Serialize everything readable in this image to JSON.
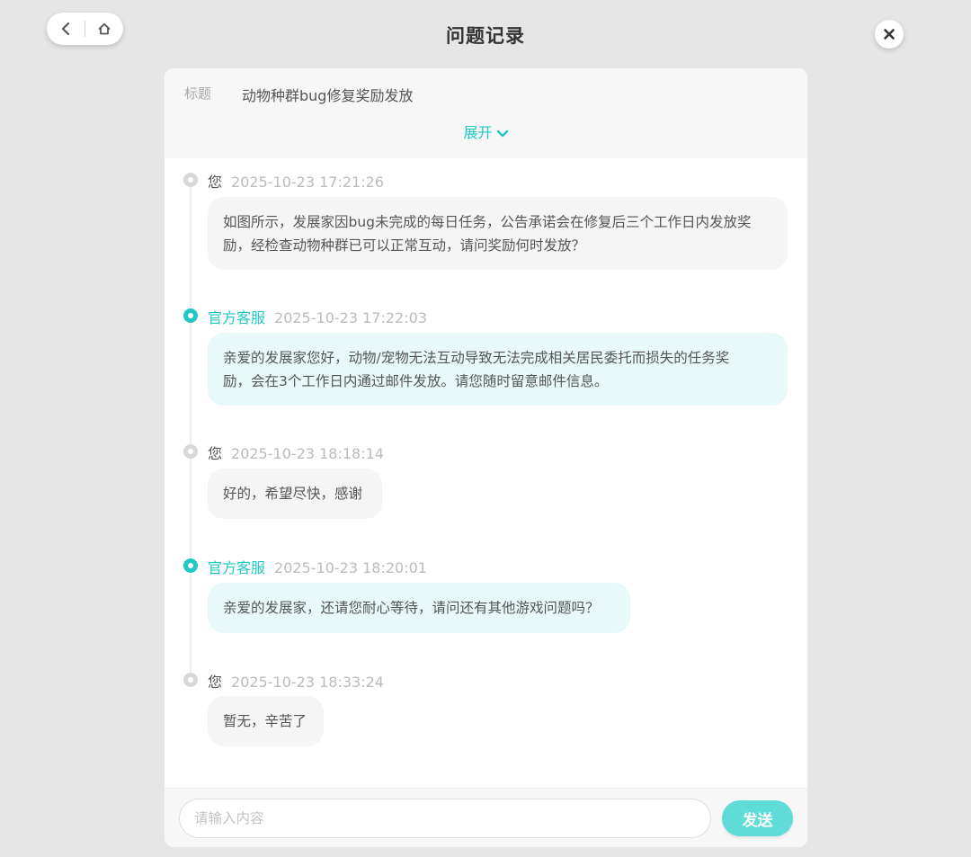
{
  "nav": {
    "back_icon": "chevron-left-icon",
    "home_icon": "home-icon",
    "close_icon": "close-icon"
  },
  "page_title": "问题记录",
  "header": {
    "label": "标题",
    "title": "动物种群bug修复奖励发放",
    "expand_label": "展开"
  },
  "colors": {
    "accent": "#22c9c4",
    "staff_bubble": "#e9f8f8",
    "user_bubble": "#f5f5f5",
    "send_button": "#5fdcd6"
  },
  "messages": [
    {
      "role": "user",
      "sender": "您",
      "time": "2025-10-23 17:21:26",
      "line1": "如图所示，发展家因bug未完成的每日任务，公告承诺会在修复后三个工作日内发放奖",
      "line2": "励，经检查动物种群已可以正常互动，请问奖励何时发放？"
    },
    {
      "role": "staff",
      "sender": "官方客服",
      "time": "2025-10-23 17:22:03",
      "line1": "亲爱的发展家您好，动物/宠物无法互动导致无法完成相关居民委托而损失的任务奖",
      "line2": "励，会在3个工作日内通过邮件发放。请您随时留意邮件信息。"
    },
    {
      "role": "user",
      "sender": "您",
      "time": "2025-10-23 18:18:14",
      "line1": "好的，希望尽快，感谢"
    },
    {
      "role": "staff",
      "sender": "官方客服",
      "time": "2025-10-23 18:20:01",
      "line1": "亲爱的发展家，还请您耐心等待，请问还有其他游戏问题吗？"
    },
    {
      "role": "user",
      "sender": "您",
      "time": "2025-10-23 18:33:24",
      "line1": "暂无，辛苦了"
    }
  ],
  "input": {
    "placeholder": "请输入内容",
    "value": "",
    "send_label": "发送"
  }
}
